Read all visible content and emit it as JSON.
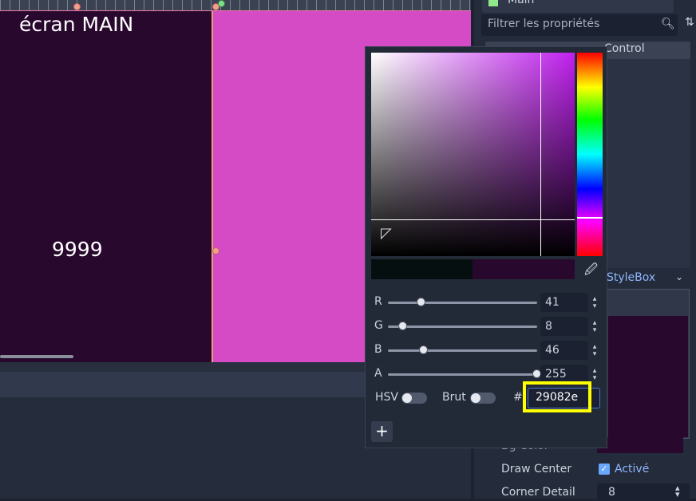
{
  "canvas": {
    "title_label": "écran MAIN",
    "score_label": "9999"
  },
  "inspector": {
    "node_name": "Main",
    "filter_placeholder": "Filtrer les propriétés",
    "section_control": "Control",
    "stylebox_label": "StyleBox",
    "bg_color_label": "Bg Color",
    "draw_center_label": "Draw Center",
    "draw_center_value": "Activé",
    "corner_detail_label": "Corner Detail",
    "corner_detail_value": "8"
  },
  "color_picker": {
    "current_color": "#29082e",
    "previous_color": "#060f0f",
    "sliders": [
      {
        "label": "R",
        "value": 41,
        "max": 255
      },
      {
        "label": "G",
        "value": 8,
        "max": 255
      },
      {
        "label": "B",
        "value": 46,
        "max": 255
      },
      {
        "label": "A",
        "value": 255,
        "max": 255
      }
    ],
    "hsv_label": "HSV",
    "raw_label": "Brut",
    "hash_label": "#",
    "hex_value": "29082e",
    "add_label": "+"
  },
  "colors": {
    "viewport_bg": "#d54bc5",
    "highlight": "#ffff00",
    "accent": "#8fb6ff"
  }
}
